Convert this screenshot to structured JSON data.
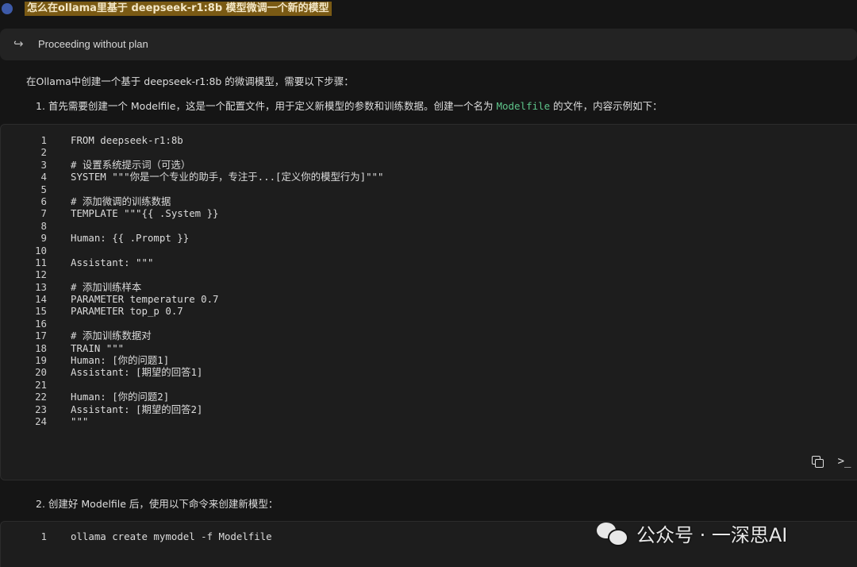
{
  "query": {
    "text": "怎么在ollama里基于 deepseek-r1:8b 模型微调一个新的模型"
  },
  "plan_bar": {
    "icon": "redirect-arrow-icon",
    "label": "Proceeding without plan"
  },
  "answer": {
    "intro": "在Ollama中创建一个基于 deepseek-r1:8b 的微调模型，需要以下步骤：",
    "step1": {
      "num": "1.",
      "pre": "首先需要创建一个 Modelfile，这是一个配置文件，用于定义新模型的参数和训练数据。创建一个名为 ",
      "code": "Modelfile",
      "post": " 的文件，内容示例如下："
    },
    "code_block_1": [
      {
        "n": "1",
        "t": "FROM deepseek-r1:8b"
      },
      {
        "n": "2",
        "t": ""
      },
      {
        "n": "3",
        "t": "# 设置系统提示词（可选）"
      },
      {
        "n": "4",
        "t": "SYSTEM \"\"\"你是一个专业的助手，专注于...[定义你的模型行为]\"\"\""
      },
      {
        "n": "5",
        "t": ""
      },
      {
        "n": "6",
        "t": "# 添加微调的训练数据"
      },
      {
        "n": "7",
        "t": "TEMPLATE \"\"\"{{ .System }}"
      },
      {
        "n": "8",
        "t": ""
      },
      {
        "n": "9",
        "t": "Human: {{ .Prompt }}"
      },
      {
        "n": "10",
        "t": ""
      },
      {
        "n": "11",
        "t": "Assistant: \"\"\""
      },
      {
        "n": "12",
        "t": ""
      },
      {
        "n": "13",
        "t": "# 添加训练样本"
      },
      {
        "n": "14",
        "t": "PARAMETER temperature 0.7"
      },
      {
        "n": "15",
        "t": "PARAMETER top_p 0.7"
      },
      {
        "n": "16",
        "t": ""
      },
      {
        "n": "17",
        "t": "# 添加训练数据对"
      },
      {
        "n": "18",
        "t": "TRAIN \"\"\""
      },
      {
        "n": "19",
        "t": "Human: [你的问题1]"
      },
      {
        "n": "20",
        "t": "Assistant: [期望的回答1]"
      },
      {
        "n": "21",
        "t": ""
      },
      {
        "n": "22",
        "t": "Human: [你的问题2]"
      },
      {
        "n": "23",
        "t": "Assistant: [期望的回答2]"
      },
      {
        "n": "24",
        "t": "\"\"\""
      }
    ],
    "step2": {
      "num": "2.",
      "text": "创建好 Modelfile 后，使用以下命令来创建新模型："
    },
    "code_block_2": [
      {
        "n": "1",
        "t": "ollama create mymodel -f Modelfile"
      }
    ]
  },
  "actions": {
    "copy_icon": "copy-icon",
    "terminal_icon": "terminal-icon",
    "terminal_glyph": ">_"
  },
  "watermark": {
    "text": "公众号 · 一深思AI"
  }
}
